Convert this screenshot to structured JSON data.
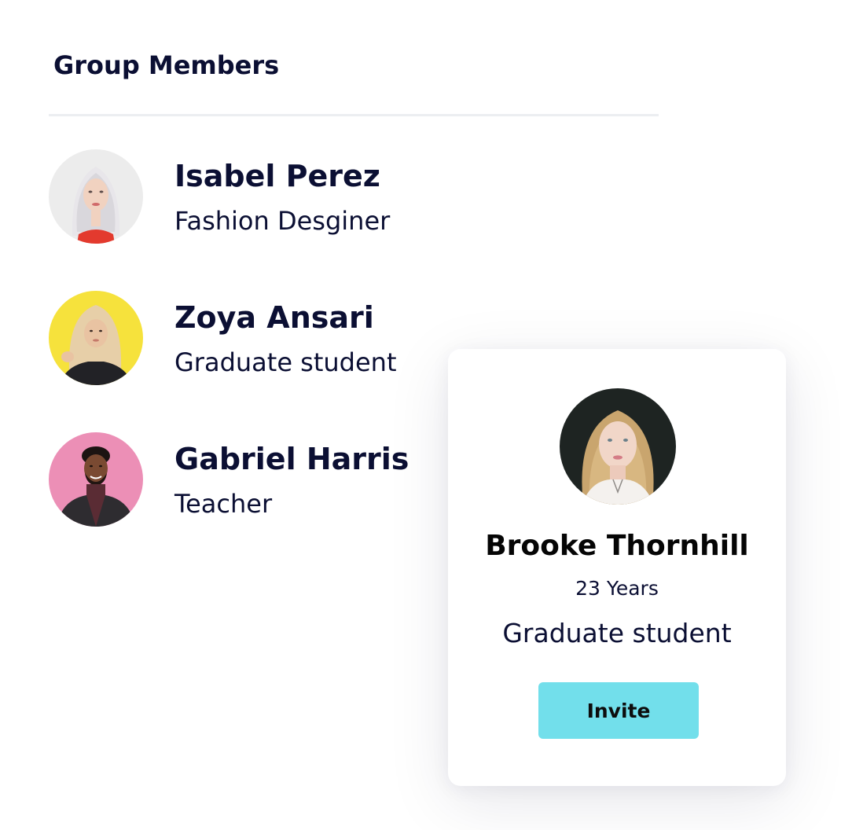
{
  "section": {
    "title": "Group Members"
  },
  "members": [
    {
      "name": "Isabel Perez",
      "role": "Fashion Desginer",
      "avatar_bg": "#eeeeee"
    },
    {
      "name": "Zoya Ansari",
      "role": "Graduate student",
      "avatar_bg": "#f6e23c"
    },
    {
      "name": "Gabriel Harris",
      "role": "Teacher",
      "avatar_bg": "#ec8fb6"
    }
  ],
  "profile_card": {
    "name": "Brooke Thornhill",
    "age": "23 Years",
    "role": "Graduate student",
    "invite_label": "Invite",
    "invite_color": "#72dfeb"
  },
  "colors": {
    "text_primary": "#0b0f33",
    "divider": "#eceef1"
  }
}
